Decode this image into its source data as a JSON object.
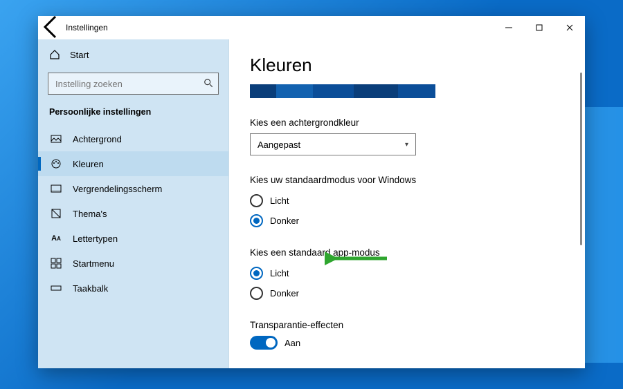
{
  "titlebar": {
    "back_aria": "Terug",
    "title": "Instellingen"
  },
  "home": {
    "label": "Start"
  },
  "search": {
    "placeholder": "Instelling zoeken"
  },
  "section_header": "Persoonlijke instellingen",
  "nav": [
    {
      "id": "achtergrond",
      "label": "Achtergrond"
    },
    {
      "id": "kleuren",
      "label": "Kleuren",
      "active": true
    },
    {
      "id": "vergrendelingsscherm",
      "label": "Vergrendelingsscherm"
    },
    {
      "id": "themas",
      "label": "Thema's"
    },
    {
      "id": "lettertypen",
      "label": "Lettertypen"
    },
    {
      "id": "startmenu",
      "label": "Startmenu"
    },
    {
      "id": "taakbalk",
      "label": "Taakbalk"
    }
  ],
  "page_title": "Kleuren",
  "bgcolor": {
    "label": "Kies een achtergrondkleur",
    "value": "Aangepast"
  },
  "windows_mode": {
    "label": "Kies uw standaardmodus voor Windows",
    "options": {
      "light": "Licht",
      "dark": "Donker"
    },
    "selected": "dark"
  },
  "app_mode": {
    "label": "Kies een standaard app-modus",
    "options": {
      "light": "Licht",
      "dark": "Donker"
    },
    "selected": "light"
  },
  "transparency": {
    "label": "Transparantie-effecten",
    "state_label": "Aan",
    "on": true
  },
  "colors": {
    "accent": "#0067c0",
    "arrow": "#2fa62f"
  }
}
